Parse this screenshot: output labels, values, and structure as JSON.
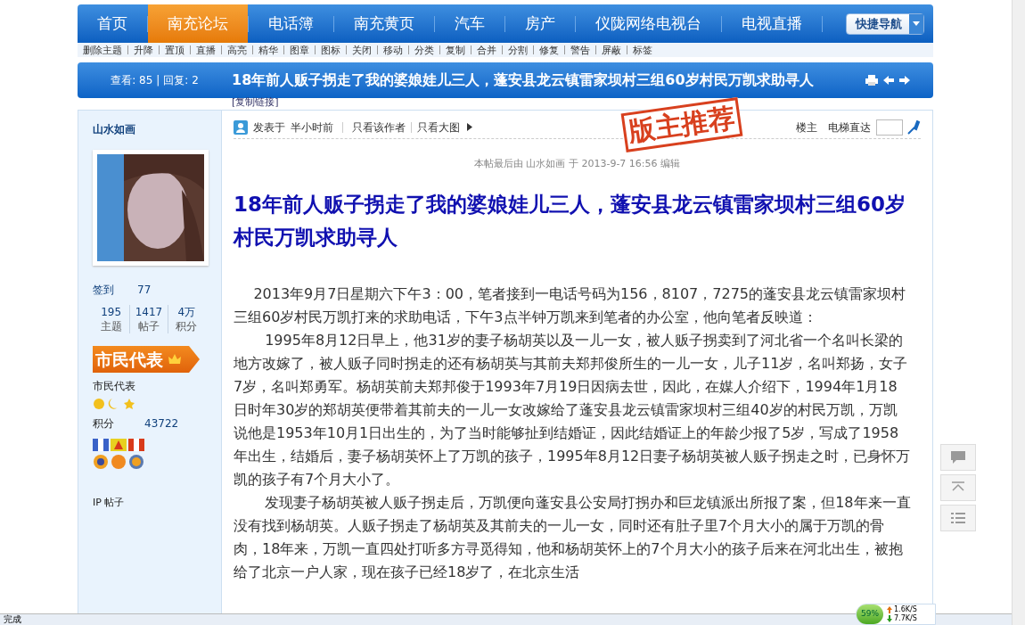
{
  "nav": {
    "items": [
      {
        "label": "首页",
        "selected": false
      },
      {
        "label": "南充论坛",
        "selected": true
      },
      {
        "label": "电话簿",
        "selected": false
      },
      {
        "label": "南充黄页",
        "selected": false
      },
      {
        "label": "汽车",
        "selected": false
      },
      {
        "label": "房产",
        "selected": false
      },
      {
        "label": "仪陇网络电视台",
        "selected": false
      },
      {
        "label": "电视直播",
        "selected": false
      }
    ],
    "quick_nav": "快捷导航"
  },
  "mod_tools": [
    "删除主题",
    "升降",
    "置顶",
    "直播",
    "高亮",
    "精华",
    "图章",
    "图标",
    "关闭",
    "移动",
    "分类",
    "复制",
    "合并",
    "分割",
    "修复",
    "警告",
    "屏蔽",
    "标签"
  ],
  "thread_bar": {
    "views": "查看: 85",
    "separator": "|",
    "replies": "回复: 2",
    "title": "18年前人贩子拐走了我的婆娘娃儿三人，蓬安县龙云镇雷家坝村三组60岁村民万凯求助寻人",
    "copy_link": "[复制链接]"
  },
  "author": {
    "name": "山水如画",
    "checkin_label": "签到",
    "checkin_value": "77",
    "counts": [
      {
        "value": "195",
        "label": "主题"
      },
      {
        "value": "1417",
        "label": "帖子"
      },
      {
        "value": "4万",
        "label": "积分"
      }
    ],
    "rank_badge": "市民代表",
    "rank": "市民代表",
    "points_label": "积分",
    "points_value": "43722",
    "ip_label": "IP 帖子"
  },
  "post": {
    "posted_label": "发表于",
    "posted_time": "半小时前",
    "author_only": "只看该作者",
    "large_images": "只看大图",
    "stamp": "版主推荐",
    "floor": "楼主",
    "jump_label": "电梯直达",
    "edit_note": "本帖最后由 山水如画 于 2013-9-7 16:56 编辑",
    "title": "18年前人贩子拐走了我的婆娘娃儿三人，蓬安县龙云镇雷家坝村三组60岁村民万凯求助寻人",
    "paragraphs": [
      "2013年9月7日星期六下午3：00，笔者接到一电话号码为156，8107，7275的蓬安县龙云镇雷家坝村三组60岁村民万凯打来的求助电话，下午3点半钟万凯来到笔者的办公室，他向笔者反映道：",
      "1995年8月12日早上，他31岁的妻子杨胡英以及一儿一女，被人贩子拐卖到了河北省一个名叫长梁的地方改嫁了，被人贩子同时拐走的还有杨胡英与其前夫郑邦俊所生的一儿一女，儿子11岁，名叫郑扬，女子7岁，名叫郑勇军。杨胡英前夫郑邦俊于1993年7月19日因病去世，因此，在媒人介绍下，1994年1月18日时年30岁的郑胡英便带着其前夫的一儿一女改嫁给了蓬安县龙云镇雷家坝村三组40岁的村民万凯，万凯说他是1953年10月1日出生的，为了当时能够扯到结婚证，因此结婚证上的年龄少报了5岁，写成了1958年出生，结婚后，妻子杨胡英怀上了万凯的孩子，1995年8月12日妻子杨胡英被人贩子拐走之时，已身怀万凯的孩子有7个月大小了。",
      "发现妻子杨胡英被人贩子拐走后，万凯便向蓬安县公安局打拐办和巨龙镇派出所报了案，但18年来一直没有找到杨胡英。人贩子拐走了杨胡英及其前夫的一儿一女，同时还有肚子里7个月大小的属于万凯的骨肉，18年来，万凯一直四处打听多方寻觅得知，他和杨胡英怀上的7个月大小的孩子后来在河北出生，被抱给了北京一户人家，现在孩子已经18岁了，在北京生活"
    ]
  },
  "status_bar": {
    "status": "完成",
    "network_load": "59%",
    "upload": "1.6K/S",
    "download": "7.7K/S"
  }
}
